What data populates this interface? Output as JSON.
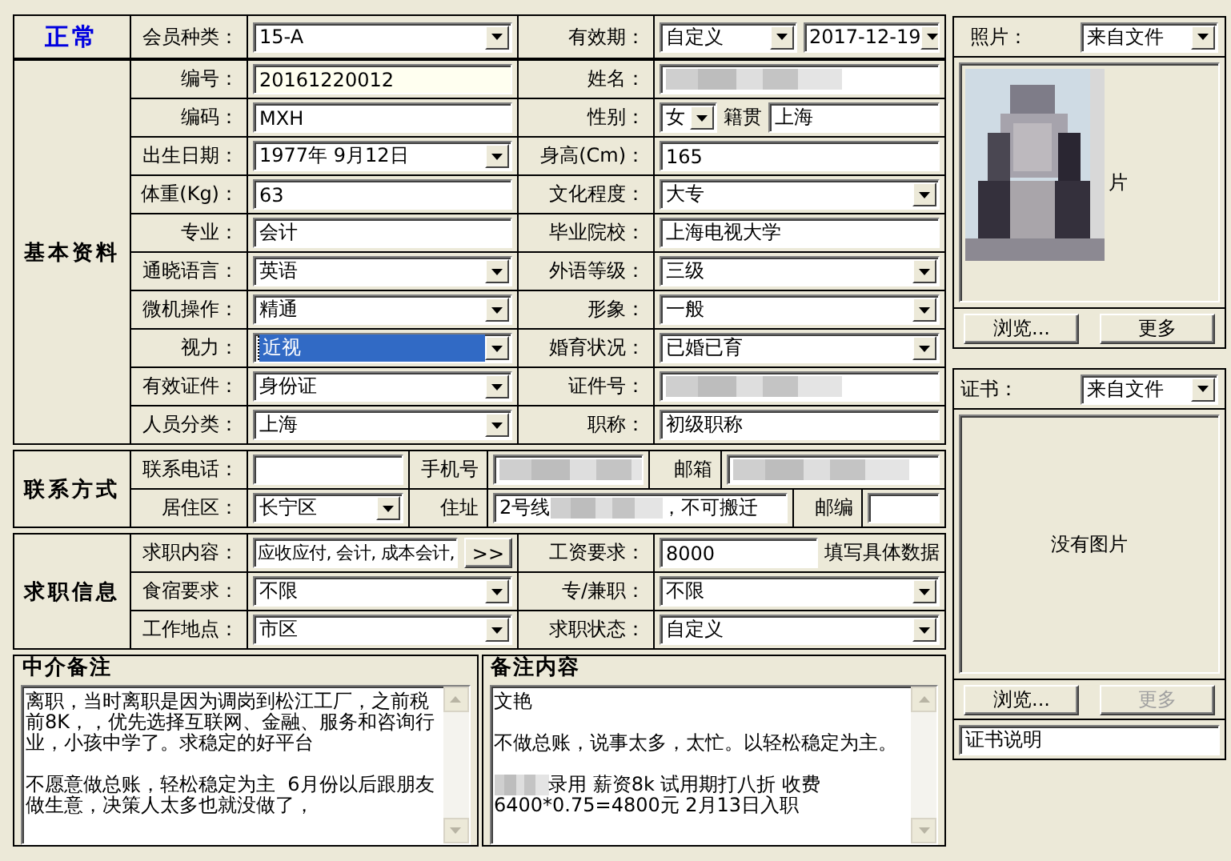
{
  "status": "正常",
  "member_type": {
    "label": "会员种类：",
    "value": "15-A"
  },
  "validity": {
    "label": "有效期：",
    "mode": "自定义",
    "date": "2017-12-19"
  },
  "basic": {
    "title": "基本资料",
    "rows": [
      {
        "left": {
          "label": "编号：",
          "kind": "readonly",
          "value": "20161220012"
        },
        "right": {
          "label": "姓名：",
          "kind": "redacted"
        }
      },
      {
        "left": {
          "label": "编码：",
          "kind": "text",
          "value": "MXH"
        },
        "right": {
          "label": "性别：",
          "kind": "gender",
          "value": "女",
          "extra_label": "籍贯",
          "extra_value": "上海"
        }
      },
      {
        "left": {
          "label": "出生日期：",
          "kind": "combo",
          "value": "1977年 9月12日"
        },
        "right": {
          "label": "身高(Cm)：",
          "kind": "text",
          "value": "165"
        }
      },
      {
        "left": {
          "label": "体重(Kg)：",
          "kind": "text",
          "value": "63"
        },
        "right": {
          "label": "文化程度：",
          "kind": "combo",
          "value": "大专"
        }
      },
      {
        "left": {
          "label": "专业：",
          "kind": "text",
          "value": "会计"
        },
        "right": {
          "label": "毕业院校：",
          "kind": "text",
          "value": "上海电视大学"
        }
      },
      {
        "left": {
          "label": "通晓语言：",
          "kind": "combo",
          "value": "英语"
        },
        "right": {
          "label": "外语等级：",
          "kind": "combo",
          "value": "三级"
        }
      },
      {
        "left": {
          "label": "微机操作：",
          "kind": "combo",
          "value": "精通"
        },
        "right": {
          "label": "形象：",
          "kind": "combo",
          "value": "一般"
        }
      },
      {
        "left": {
          "label": "视力：",
          "kind": "combo-focused",
          "value": "近视"
        },
        "right": {
          "label": "婚育状况：",
          "kind": "combo",
          "value": "已婚已育"
        }
      },
      {
        "left": {
          "label": "有效证件：",
          "kind": "combo",
          "value": "身份证"
        },
        "right": {
          "label": "证件号：",
          "kind": "redacted"
        }
      },
      {
        "left": {
          "label": "人员分类：",
          "kind": "combo",
          "value": "上海"
        },
        "right": {
          "label": "职称：",
          "kind": "text",
          "value": "初级职称"
        }
      }
    ]
  },
  "contact": {
    "title": "联系方式",
    "phone": {
      "label": "联系电话：",
      "kind": "text"
    },
    "mobile": {
      "label": "手机号",
      "kind": "redacted"
    },
    "email": {
      "label": "邮箱",
      "kind": "redacted"
    },
    "district": {
      "label": "居住区：",
      "kind": "combo",
      "value": "长宁区"
    },
    "address": {
      "label": "住址",
      "kind": "address",
      "value": "2号线",
      "value_after": "，不可搬迁"
    },
    "postcode": {
      "label": "邮编",
      "kind": "text"
    }
  },
  "job": {
    "title": "求职信息",
    "rows": [
      [
        {
          "label": "求职内容：",
          "kind": "picker",
          "value": "应收应付, 会计, 成本会计,",
          "button": ">>"
        },
        {
          "label": "工资要求：",
          "kind": "hinted",
          "value": "8000",
          "hint": "填写具体数据"
        }
      ],
      [
        {
          "label": "食宿要求：",
          "kind": "combo",
          "value": "不限"
        },
        {
          "label": "专/兼职：",
          "kind": "combo",
          "value": "不限"
        }
      ],
      [
        {
          "label": "工作地点：",
          "kind": "combo",
          "value": "市区"
        },
        {
          "label": "求职状态：",
          "kind": "combo",
          "value": "自定义"
        }
      ]
    ]
  },
  "notes": [
    {
      "title": "中介备注",
      "paragraphs": [
        {
          "kind": "plain",
          "lines": [
            "离职，当时离职是因为调岗到松江工厂，之前税前8K，，优先选择互联网、金融、服务和咨询行业，小孩中学了。求稳定的好平台"
          ]
        },
        {
          "kind": "plain",
          "lines": [
            "不愿意做总账，轻松稳定为主  6月份以后跟朋友做生意，决策人太多也就没做了，"
          ]
        }
      ]
    },
    {
      "title": "备注内容",
      "paragraphs": [
        {
          "kind": "plain",
          "lines": [
            "文艳"
          ]
        },
        {
          "kind": "plain",
          "lines": [
            "不做总账，说事太多，太忙。以轻松稳定为主。"
          ]
        },
        {
          "kind": "redacted-start",
          "lines": [
            "录用 薪资8k 试用期打八折 收费",
            "6400*0.75=4800元 2月13日入职"
          ]
        }
      ]
    }
  ],
  "photo": {
    "label": "照片：",
    "source": "来自文件",
    "behind_text": "片",
    "buttons": [
      {
        "label": "浏览...",
        "disabled": false
      },
      {
        "label": "更多",
        "disabled": false
      }
    ]
  },
  "certificate": {
    "label": "证书：",
    "source": "来自文件",
    "empty_text": "没有图片",
    "buttons": [
      {
        "label": "浏览...",
        "disabled": false
      },
      {
        "label": "更多",
        "disabled": true
      }
    ],
    "caption": "证书说明"
  }
}
